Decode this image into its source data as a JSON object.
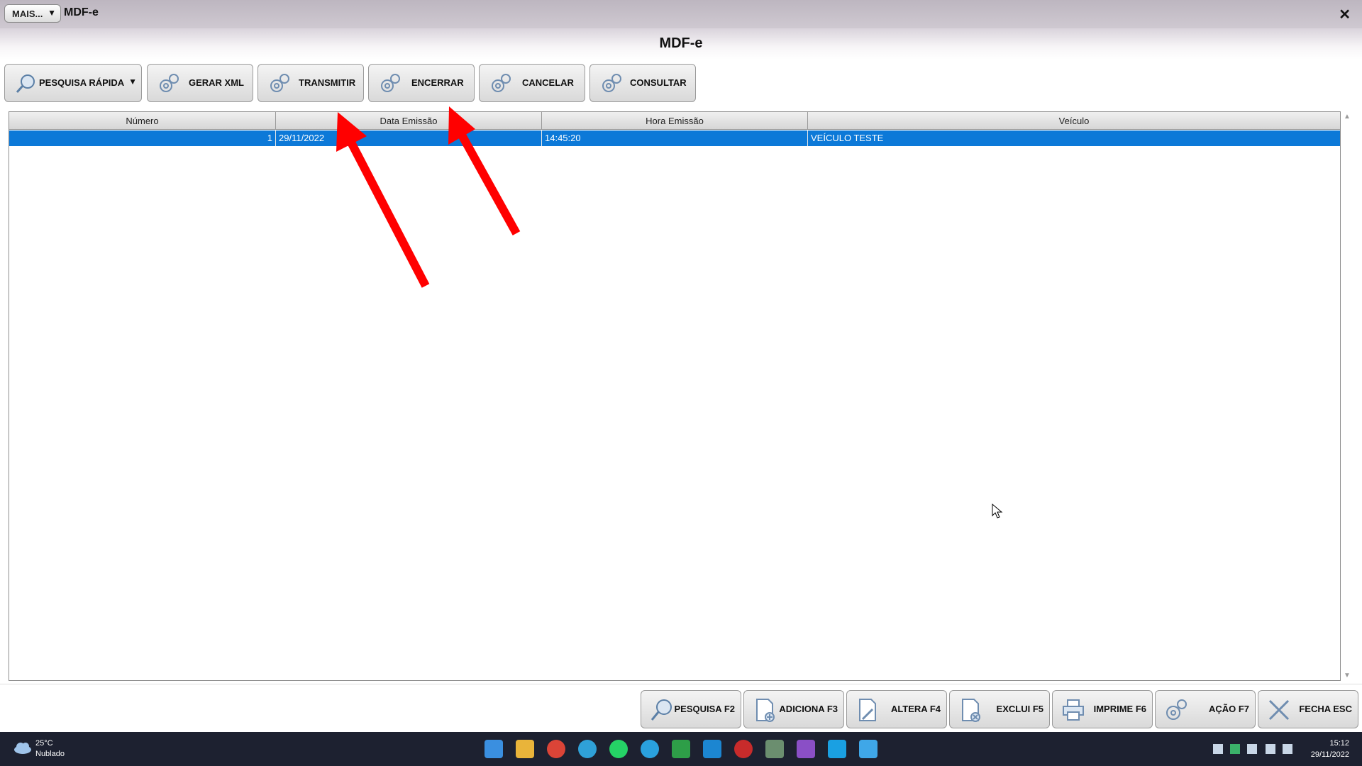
{
  "window": {
    "mais_label": "MAIS...",
    "title": "MDF-e",
    "close_label": "✕"
  },
  "page": {
    "title": "MDF-e"
  },
  "toolbar": {
    "pesquisa_rapida": "PESQUISA RÁPIDA",
    "gerar_xml": "GERAR XML",
    "transmitir": "TRANSMITIR",
    "encerrar": "ENCERRAR",
    "cancelar": "CANCELAR",
    "consultar": "CONSULTAR"
  },
  "grid": {
    "columns": [
      "Número",
      "Data Emissão",
      "Hora Emissão",
      "Veículo"
    ],
    "rows": [
      {
        "numero": "1",
        "data": "29/11/2022",
        "hora": "14:45:20",
        "veiculo": "VEÍCULO TESTE"
      }
    ]
  },
  "bottom": {
    "pesquisa": "PESQUISA F2",
    "adiciona": "ADICIONA F3",
    "altera": "ALTERA F4",
    "exclui": "EXCLUI F5",
    "imprime": "IMPRIME F6",
    "acao": "AÇÃO F7",
    "fecha": "FECHA ESC"
  },
  "taskbar": {
    "weather_temp": "25°C",
    "weather_desc": "Nublado",
    "time": "15:12",
    "date": "29/11/2022",
    "apps": [
      "windows-start-icon",
      "file-explorer-icon",
      "chrome-icon",
      "edge-icon",
      "whatsapp-icon",
      "telegram-icon",
      "spreadsheet-icon",
      "remote-icon",
      "app-red-icon",
      "app-active-icon",
      "video-icon",
      "mail-icon",
      "notepad-icon"
    ]
  },
  "colors": {
    "selection": "#0c79d8",
    "annotation_arrow": "#ff0000",
    "taskbar": "#1d2130"
  }
}
